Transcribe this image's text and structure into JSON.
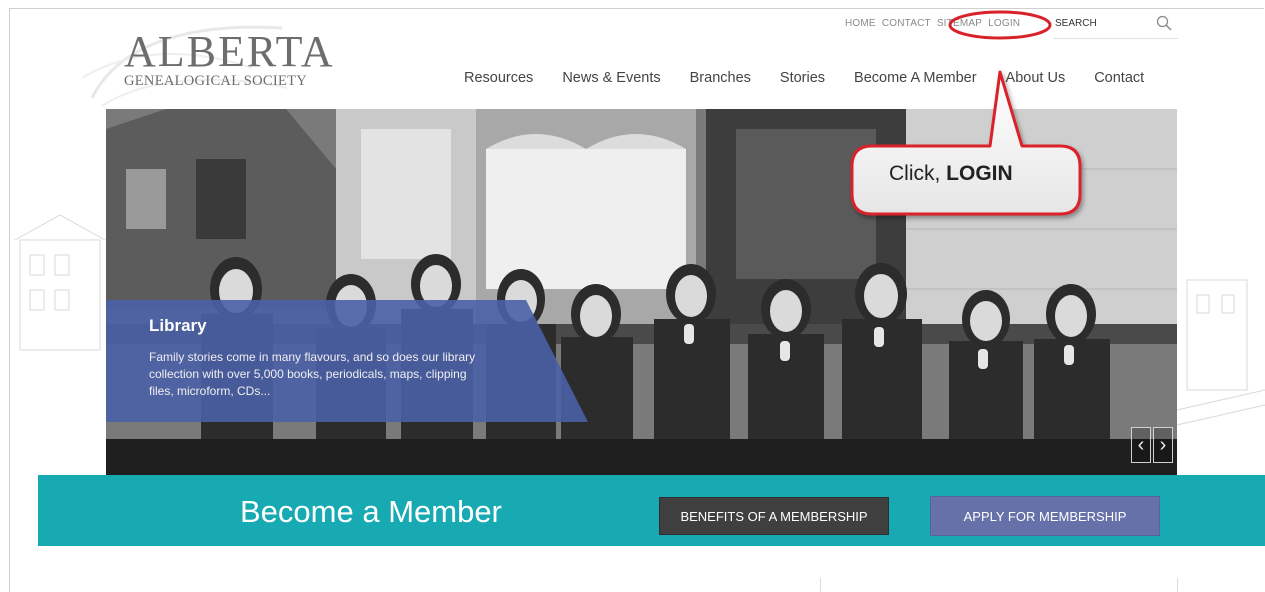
{
  "logo": {
    "main": "ALBERTA",
    "sub": "GENEALOGICAL SOCIETY"
  },
  "util_nav": [
    "HOME",
    "CONTACT",
    "SITEMAP",
    "LOGIN"
  ],
  "search": {
    "label": "SEARCH",
    "icon": "search-icon"
  },
  "main_nav": [
    "Resources",
    "News & Events",
    "Branches",
    "Stories",
    "Become A Member",
    "About Us",
    "Contact"
  ],
  "hero": {
    "caption_title": "Library",
    "caption_text": "Family stories come in many flavours, and so does our library collection with over 5,000 books, periodicals, maps, clipping files, microform, CDs...",
    "prev_icon": "chevron-left-icon",
    "next_icon": "chevron-right-icon",
    "prev_glyph": "‹",
    "next_glyph": "›"
  },
  "band": {
    "title": "Become a Member",
    "benefits_button": "BENEFITS OF A MEMBERSHIP",
    "apply_button": "APPLY FOR MEMBERSHIP"
  },
  "annotation": {
    "prefix": "Click, ",
    "emphasis": "LOGIN"
  },
  "colors": {
    "teal": "#17aab2",
    "caption_blue": "#4a5fa6",
    "apply_button": "#6571a8",
    "callout_red": "#d9232a"
  }
}
